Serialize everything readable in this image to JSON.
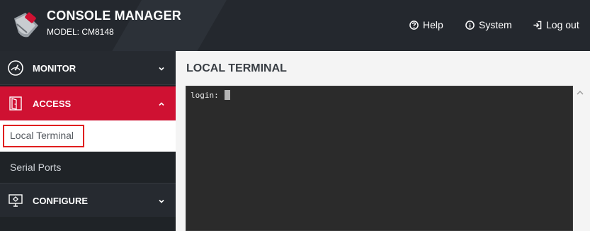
{
  "header": {
    "title": "CONSOLE MANAGER",
    "model": "MODEL: CM8148",
    "nav": {
      "help": "Help",
      "system": "System",
      "logout": "Log out"
    }
  },
  "sidebar": {
    "monitor": "MONITOR",
    "access": "ACCESS",
    "access_items": [
      "Local Terminal",
      "Serial Ports"
    ],
    "configure": "CONFIGURE"
  },
  "main": {
    "title": "LOCAL TERMINAL",
    "terminal_prompt": "login:"
  },
  "colors": {
    "header_bg": "#24282e",
    "accent": "#cf1132",
    "highlight_box": "#e01f1f",
    "terminal_bg": "#2b2b2b"
  }
}
